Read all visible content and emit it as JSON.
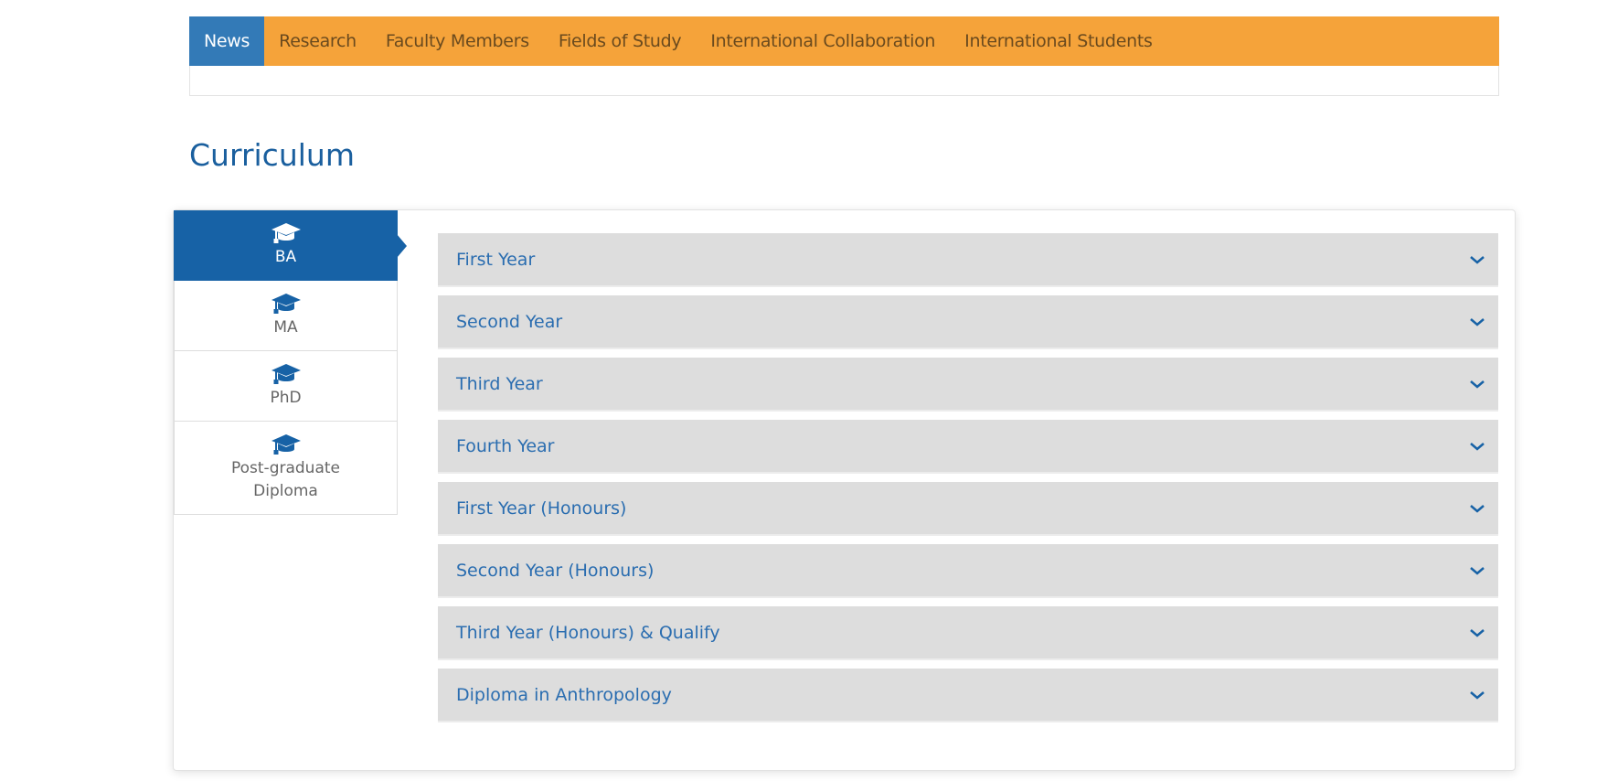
{
  "nav": {
    "items": [
      "News",
      "Research",
      "Faculty Members",
      "Fields of Study",
      "International Collaboration",
      "International Students"
    ],
    "active": "News"
  },
  "page": {
    "title": "Curriculum"
  },
  "tabs": [
    {
      "label": "BA",
      "icon": "graduation-cap-icon"
    },
    {
      "label": "MA",
      "icon": "graduation-cap-icon"
    },
    {
      "label": "PhD",
      "icon": "graduation-cap-icon"
    },
    {
      "label": "Post-graduate Diploma",
      "icon": "graduation-cap-icon"
    }
  ],
  "accordion": [
    "First Year",
    "Second Year",
    "Third Year",
    "Fourth Year",
    "First Year (Honours)",
    "Second Year (Honours)",
    "Third Year (Honours) & Qualify",
    "Diploma in Anthropology"
  ],
  "colors": {
    "nav": "#f5a33a",
    "nav_active": "#337ab7",
    "tab_active": "#1762a6",
    "accordion_bg": "#dddddd",
    "accent_text": "#2a6db0"
  }
}
